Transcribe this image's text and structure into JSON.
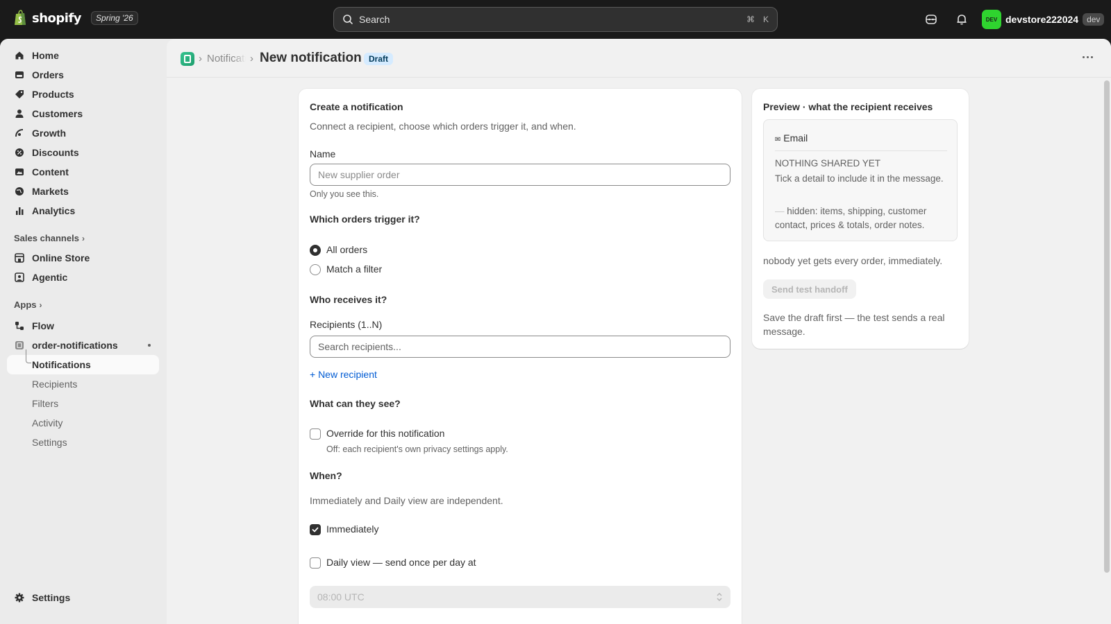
{
  "topbar": {
    "brand": "shopify",
    "edition": "Spring '26",
    "search_placeholder": "Search",
    "shortcut_cmd": "⌘",
    "shortcut_key": "K",
    "store_avatar": "DEV",
    "store_name": "devstore222024",
    "store_env": "dev"
  },
  "sidebar": {
    "main_items": [
      {
        "label": "Home",
        "icon": "home-icon"
      },
      {
        "label": "Orders",
        "icon": "orders-icon"
      },
      {
        "label": "Products",
        "icon": "tag-icon"
      },
      {
        "label": "Customers",
        "icon": "person-icon"
      },
      {
        "label": "Growth",
        "icon": "growth-icon"
      },
      {
        "label": "Discounts",
        "icon": "discount-icon"
      },
      {
        "label": "Content",
        "icon": "content-icon"
      },
      {
        "label": "Markets",
        "icon": "globe-icon"
      },
      {
        "label": "Analytics",
        "icon": "bar-chart-icon"
      }
    ],
    "sales_channels_label": "Sales channels",
    "channels": [
      {
        "label": "Online Store"
      },
      {
        "label": "Agentic"
      }
    ],
    "apps_label": "Apps",
    "apps": [
      {
        "label": "Flow"
      },
      {
        "label": "order-notifications"
      }
    ],
    "app_sub_items": [
      {
        "label": "Notifications",
        "active": true
      },
      {
        "label": "Recipients"
      },
      {
        "label": "Filters"
      },
      {
        "label": "Activity"
      },
      {
        "label": "Settings"
      }
    ],
    "settings_label": "Settings"
  },
  "header": {
    "breadcrumb": "Notifications",
    "title": "New notification",
    "status_badge": "Draft"
  },
  "form": {
    "title": "Create a notification",
    "subtitle": "Connect a recipient, choose which orders trigger it, and when.",
    "name_label": "Name",
    "name_placeholder": "New supplier order",
    "name_help": "Only you see this.",
    "trigger_heading": "Which orders trigger it?",
    "trigger_options": [
      {
        "label": "All orders",
        "selected": true
      },
      {
        "label": "Match a filter",
        "selected": false
      }
    ],
    "recipients_heading": "Who receives it?",
    "recipients_label": "Recipients (1..N)",
    "recipients_placeholder": "Search recipients...",
    "new_recipient_link": "+ New recipient",
    "visibility_heading": "What can they see?",
    "override_label": "Override for this notification",
    "override_checked": false,
    "override_help": "Off: each recipient's own privacy settings apply.",
    "when_heading": "When?",
    "when_help": "Immediately and Daily view are independent.",
    "immediately_label": "Immediately",
    "immediately_checked": true,
    "daily_label": "Daily view — send once per day at",
    "daily_checked": false,
    "daily_time": "08:00 UTC"
  },
  "preview": {
    "title": "Preview · what the recipient receives",
    "channel_icon": "✉",
    "channel_label": "Email",
    "empty_title": "NOTHING SHARED YET",
    "empty_text": "Tick a detail to include it in the message.",
    "hidden_dash": "—",
    "hidden_text": "hidden: items, shipping, customer contact, prices & totals, order notes.",
    "summary": "nobody yet gets every order, immediately.",
    "test_button": "Send test handoff",
    "test_note": "Save the draft first — the test sends a real message."
  }
}
